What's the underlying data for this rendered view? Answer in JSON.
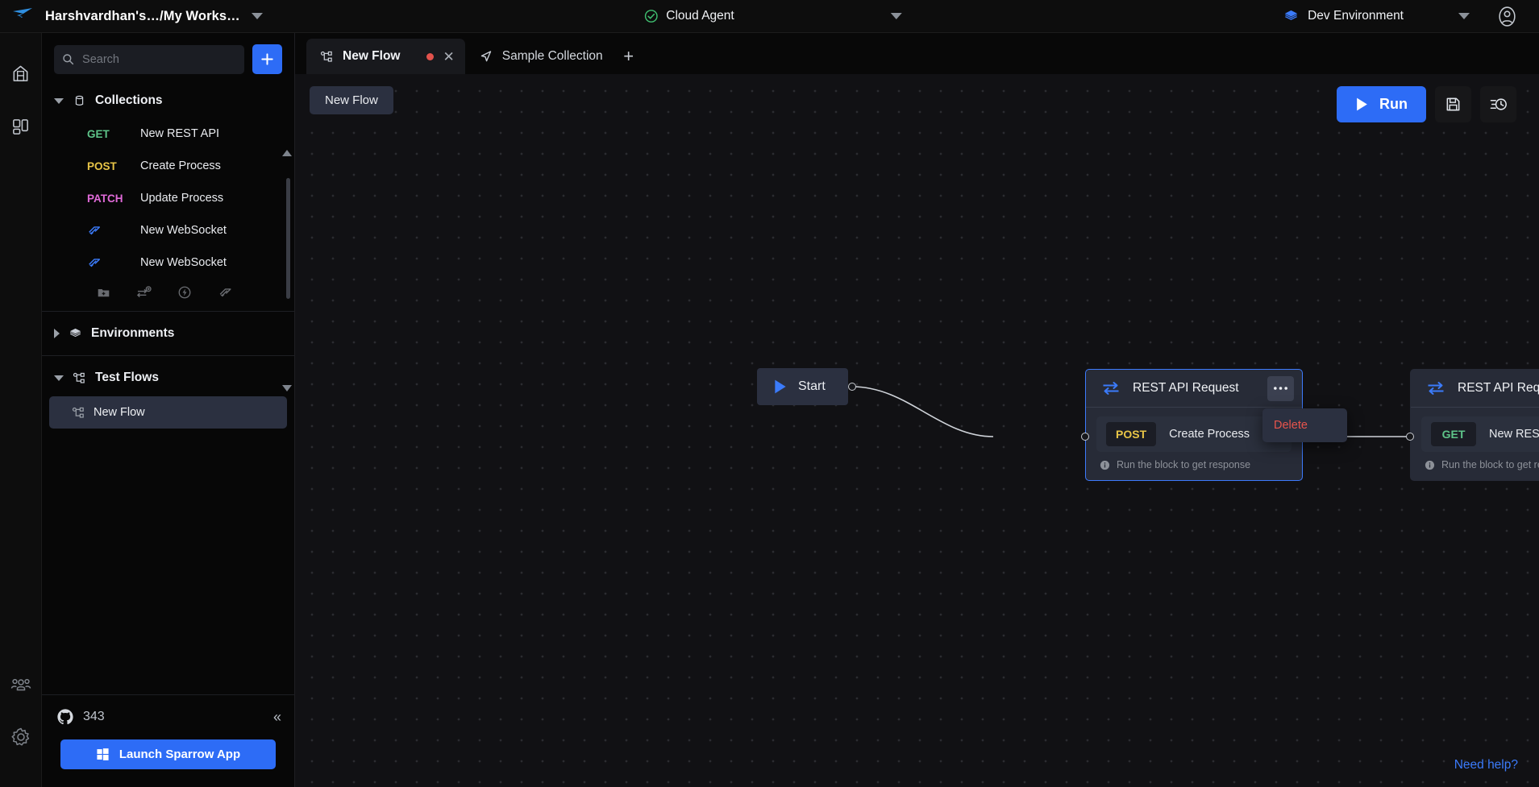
{
  "topbar": {
    "logo_icon": "sparrow-bird-logo",
    "workspace_breadcrumb": "Harshvardhan's…/My Works…",
    "workspace_caret_icon": "chevron-down-icon",
    "agent": {
      "icon": "check-circle-icon",
      "label": "Cloud Agent",
      "caret_icon": "chevron-down-icon"
    },
    "environment": {
      "icon": "layers-icon",
      "label": "Dev Environment",
      "caret_icon": "chevron-down-icon"
    },
    "account_icon": "user-account-icon"
  },
  "rail": {
    "items": [
      {
        "name": "home",
        "icon": "home-icon"
      },
      {
        "name": "workspaces",
        "icon": "grid-blocks-icon"
      }
    ],
    "bottom_items": [
      {
        "name": "team",
        "icon": "people-team-icon"
      },
      {
        "name": "settings",
        "icon": "gear-icon"
      }
    ]
  },
  "sidebar": {
    "search": {
      "placeholder": "Search",
      "value": "",
      "icon": "search-icon"
    },
    "add_button": {
      "icon": "plus-icon",
      "label": "+"
    },
    "collections": {
      "title": "Collections",
      "icon": "collection-jar-icon",
      "expanded": true,
      "items": [
        {
          "method": "GET",
          "method_class": "m-get",
          "name": "New REST API"
        },
        {
          "method": "POST",
          "method_class": "m-post",
          "name": "Create Process"
        },
        {
          "method": "PATCH",
          "method_class": "m-patch",
          "name": "Update Process"
        },
        {
          "method": "",
          "method_class": "",
          "name": "New WebSocket",
          "icon": "websocket-icon"
        },
        {
          "method": "",
          "method_class": "",
          "name": "New WebSocket",
          "icon": "websocket-icon"
        }
      ],
      "mini_actions": [
        {
          "name": "add-folder",
          "icon": "folder-plus-icon"
        },
        {
          "name": "add-request",
          "icon": "request-plus-icon"
        },
        {
          "name": "add-socketio",
          "icon": "bolt-circle-icon"
        },
        {
          "name": "add-websocket",
          "icon": "websocket-icon"
        }
      ]
    },
    "environments": {
      "title": "Environments",
      "icon": "layers-icon",
      "expanded": false
    },
    "test_flows": {
      "title": "Test Flows",
      "icon": "flow-nodes-icon",
      "expanded": true,
      "items": [
        {
          "name": "New Flow",
          "icon": "flow-nodes-icon",
          "selected": true
        }
      ]
    },
    "footer": {
      "github_icon": "github-icon",
      "github_stars": "343",
      "collapse_icon": "chevrons-left-icon",
      "launch_button": {
        "label": "Launch Sparrow App",
        "icon": "windows-logo-icon"
      }
    }
  },
  "tabs": {
    "items": [
      {
        "label": "New Flow",
        "icon": "flow-nodes-icon",
        "active": true,
        "dirty": true,
        "close_icon": "close-icon"
      },
      {
        "label": "Sample Collection",
        "icon": "collection-send-icon",
        "active": false,
        "dirty": false
      }
    ],
    "new_tab_icon": "plus-icon"
  },
  "canvas": {
    "flow_chip_label": "New Flow",
    "toolbar": {
      "run_button": {
        "label": "Run",
        "icon": "play-icon",
        "color": "#2d6cf6"
      },
      "save_button": {
        "icon": "save-floppy-icon"
      },
      "history_button": {
        "icon": "history-clock-icon"
      }
    },
    "need_help_link": "Need help?",
    "nodes": [
      {
        "id": "start",
        "type": "start",
        "label": "Start",
        "icon": "play-icon"
      },
      {
        "id": "node-1",
        "type": "rest-api-request",
        "title": "REST API Request",
        "icon": "swap-arrows-icon",
        "menu_icon": "ellipsis-icon",
        "selected": true,
        "request": {
          "method": "POST",
          "method_class": "b-post",
          "name": "Create Process"
        },
        "footer": {
          "icon": "info-icon",
          "text": "Run the block to get response"
        }
      },
      {
        "id": "node-2",
        "type": "rest-api-request",
        "title": "REST API Request",
        "icon": "swap-arrows-icon",
        "menu_icon": "ellipsis-icon",
        "selected": false,
        "request": {
          "method": "GET",
          "method_class": "b-get",
          "name": "New REST API"
        },
        "footer": {
          "icon": "info-icon",
          "text": "Run the block to get response"
        }
      }
    ],
    "context_menu": {
      "visible": true,
      "items": [
        {
          "label": "Delete",
          "color": "#e8544c"
        }
      ]
    }
  }
}
